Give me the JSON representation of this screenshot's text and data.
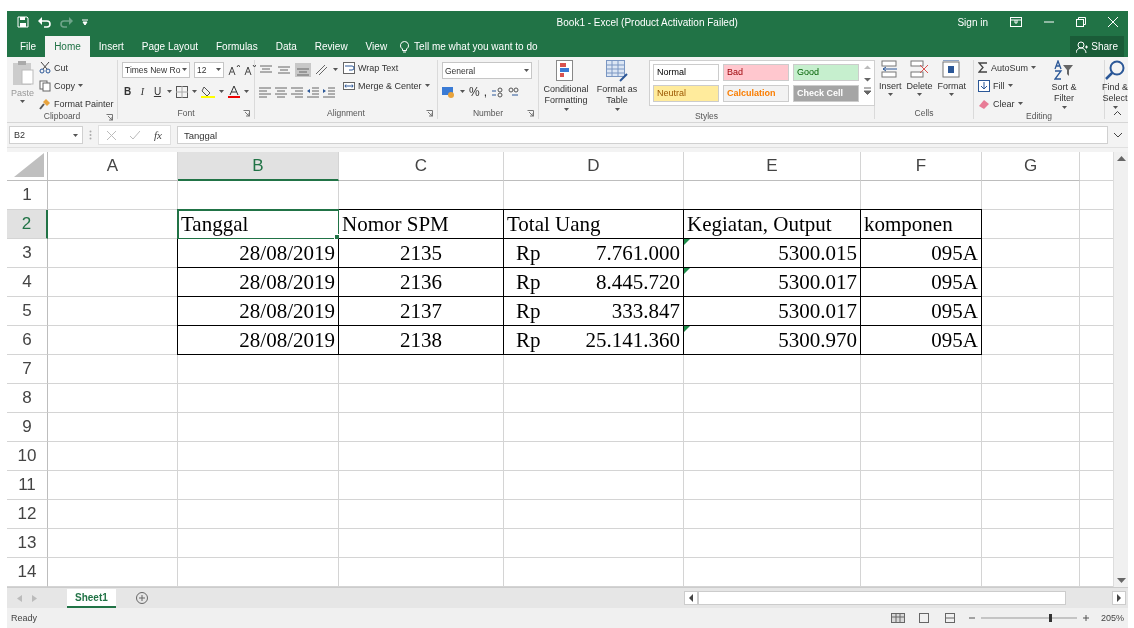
{
  "window": {
    "title": "Book1 - Excel (Product Activation Failed)",
    "sign_in": "Sign in",
    "share": "Share"
  },
  "tabs": [
    {
      "label": "File",
      "selected": false
    },
    {
      "label": "Home",
      "selected": true
    },
    {
      "label": "Insert",
      "selected": false
    },
    {
      "label": "Page Layout",
      "selected": false
    },
    {
      "label": "Formulas",
      "selected": false
    },
    {
      "label": "Data",
      "selected": false
    },
    {
      "label": "Review",
      "selected": false
    },
    {
      "label": "View",
      "selected": false
    }
  ],
  "tell_me": "Tell me what you want to do",
  "ribbon": [
    {
      "kind": "clipboard",
      "label": "Clipboard",
      "paste": "Paste",
      "items": [
        "Cut",
        "Copy",
        "Format Painter"
      ]
    },
    {
      "kind": "font",
      "label": "Font",
      "font_name": "Times New Ro",
      "font_size": "12",
      "styles": [
        "B",
        "I",
        "U"
      ]
    },
    {
      "kind": "alignment",
      "label": "Alignment",
      "wrap": "Wrap Text",
      "merge": "Merge & Center"
    },
    {
      "kind": "number",
      "label": "Number",
      "format": "General",
      "symbols": [
        "%",
        ","
      ]
    },
    {
      "kind": "styles",
      "label": "Styles",
      "commands": [
        "Conditional Formatting",
        "Format as Table"
      ],
      "cell_styles": [
        {
          "label": "Normal",
          "kind": "normal",
          "color": "#ffffff"
        },
        {
          "label": "Bad",
          "kind": "bad",
          "color": "#ffc7ce"
        },
        {
          "label": "Good",
          "kind": "good",
          "color": "#c6efce"
        },
        {
          "label": "Neutral",
          "kind": "neutral",
          "color": "#ffeb9c"
        },
        {
          "label": "Calculation",
          "kind": "calculation",
          "color": "#f2f2f2"
        },
        {
          "label": "Check Cell",
          "kind": "check",
          "color": "#a5a5a5"
        }
      ]
    },
    {
      "kind": "cells",
      "label": "Cells",
      "items": [
        "Insert",
        "Delete",
        "Format"
      ]
    },
    {
      "kind": "editing",
      "label": "Editing",
      "items": [
        "AutoSum",
        "Fill",
        "Clear"
      ],
      "commands": [
        "Sort & Filter",
        "Find & Select"
      ]
    }
  ],
  "formula_bar": {
    "name_box": "B2",
    "fx": "fx",
    "value": "Tanggal"
  },
  "sheet": {
    "columns": [
      {
        "label": "A",
        "selected": false
      },
      {
        "label": "B",
        "selected": true
      },
      {
        "label": "C",
        "selected": false
      },
      {
        "label": "D",
        "selected": false
      },
      {
        "label": "E",
        "selected": false
      },
      {
        "label": "F",
        "selected": false
      },
      {
        "label": "G",
        "selected": false
      }
    ],
    "rows": [
      {
        "label": "1",
        "selected": false
      },
      {
        "label": "2",
        "selected": true,
        "cells": [
          {
            "text": "Tanggal",
            "kind": "text",
            "bordered": true,
            "selected": true
          },
          {
            "text": "Nomor SPM",
            "kind": "text",
            "bordered": true,
            "selected": false
          },
          {
            "text": "Total Uang",
            "kind": "text",
            "bordered": true,
            "selected": false
          },
          {
            "text": "Kegiatan, Output",
            "kind": "text",
            "bordered": true,
            "selected": false
          },
          {
            "text": "komponen",
            "kind": "text",
            "bordered": true,
            "selected": false
          }
        ]
      },
      {
        "label": "3",
        "selected": false,
        "cells": [
          {
            "text": "28/08/2019",
            "kind": "number",
            "bordered": true,
            "selected": false
          },
          {
            "text": "2135",
            "kind": "centered",
            "bordered": true,
            "selected": false
          },
          {
            "currency": "Rp",
            "text": "7.761.000",
            "kind": "accounting",
            "bordered": true,
            "selected": false
          },
          {
            "text": "5300.015",
            "kind": "number",
            "bordered": true,
            "selected": false,
            "flagged": true
          },
          {
            "text": "095A",
            "kind": "number",
            "bordered": true,
            "selected": false
          }
        ]
      },
      {
        "label": "4",
        "selected": false,
        "cells": [
          {
            "text": "28/08/2019",
            "kind": "number",
            "bordered": true,
            "selected": false
          },
          {
            "text": "2136",
            "kind": "centered",
            "bordered": true,
            "selected": false
          },
          {
            "currency": "Rp",
            "text": "8.445.720",
            "kind": "accounting",
            "bordered": true,
            "selected": false
          },
          {
            "text": "5300.017",
            "kind": "number",
            "bordered": true,
            "selected": false,
            "flagged": true
          },
          {
            "text": "095A",
            "kind": "number",
            "bordered": true,
            "selected": false
          }
        ]
      },
      {
        "label": "5",
        "selected": false,
        "cells": [
          {
            "text": "28/08/2019",
            "kind": "number",
            "bordered": true,
            "selected": false
          },
          {
            "text": "2137",
            "kind": "centered",
            "bordered": true,
            "selected": false
          },
          {
            "currency": "Rp",
            "text": "333.847",
            "kind": "accounting",
            "bordered": true,
            "selected": false
          },
          {
            "text": "5300.017",
            "kind": "number",
            "bordered": true,
            "selected": false
          },
          {
            "text": "095A",
            "kind": "number",
            "bordered": true,
            "selected": false
          }
        ]
      },
      {
        "label": "6",
        "selected": false,
        "cells": [
          {
            "text": "28/08/2019",
            "kind": "number",
            "bordered": true,
            "selected": false
          },
          {
            "text": "2138",
            "kind": "centered",
            "bordered": true,
            "selected": false
          },
          {
            "currency": "Rp",
            "text": "25.141.360",
            "kind": "accounting",
            "bordered": true,
            "selected": false
          },
          {
            "text": "5300.970",
            "kind": "number",
            "bordered": true,
            "selected": false,
            "flagged": true
          },
          {
            "text": "095A",
            "kind": "number",
            "bordered": true,
            "selected": false
          }
        ]
      },
      {
        "label": "7",
        "selected": false
      },
      {
        "label": "8",
        "selected": false
      },
      {
        "label": "9",
        "selected": false
      },
      {
        "label": "10",
        "selected": false
      },
      {
        "label": "11",
        "selected": false
      },
      {
        "label": "12",
        "selected": false
      },
      {
        "label": "13",
        "selected": false
      },
      {
        "label": "14",
        "selected": false
      }
    ]
  },
  "sheet_tabs": [
    {
      "label": "Sheet1",
      "selected": true
    }
  ],
  "status_bar": {
    "text": "Ready",
    "zoom": "205%"
  }
}
